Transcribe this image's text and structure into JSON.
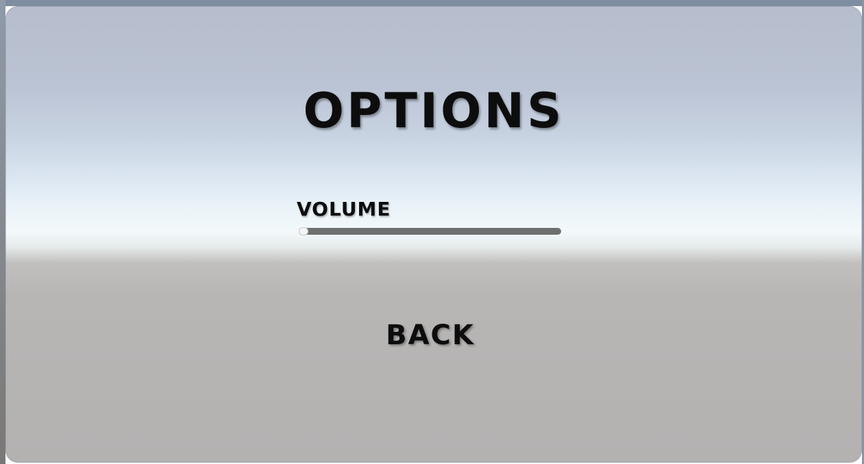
{
  "menu": {
    "title": "OPTIONS",
    "volume": {
      "label": "VOLUME",
      "value": 0.0
    },
    "back_label": "BACK"
  },
  "colors": {
    "sky_top": "#b6bdcd",
    "horizon": "#f3f9fb",
    "ground": "#b3b2b1",
    "text": "#0d0d0d",
    "slider_track": "#6e706f",
    "slider_handle": "#f4f4f4"
  }
}
